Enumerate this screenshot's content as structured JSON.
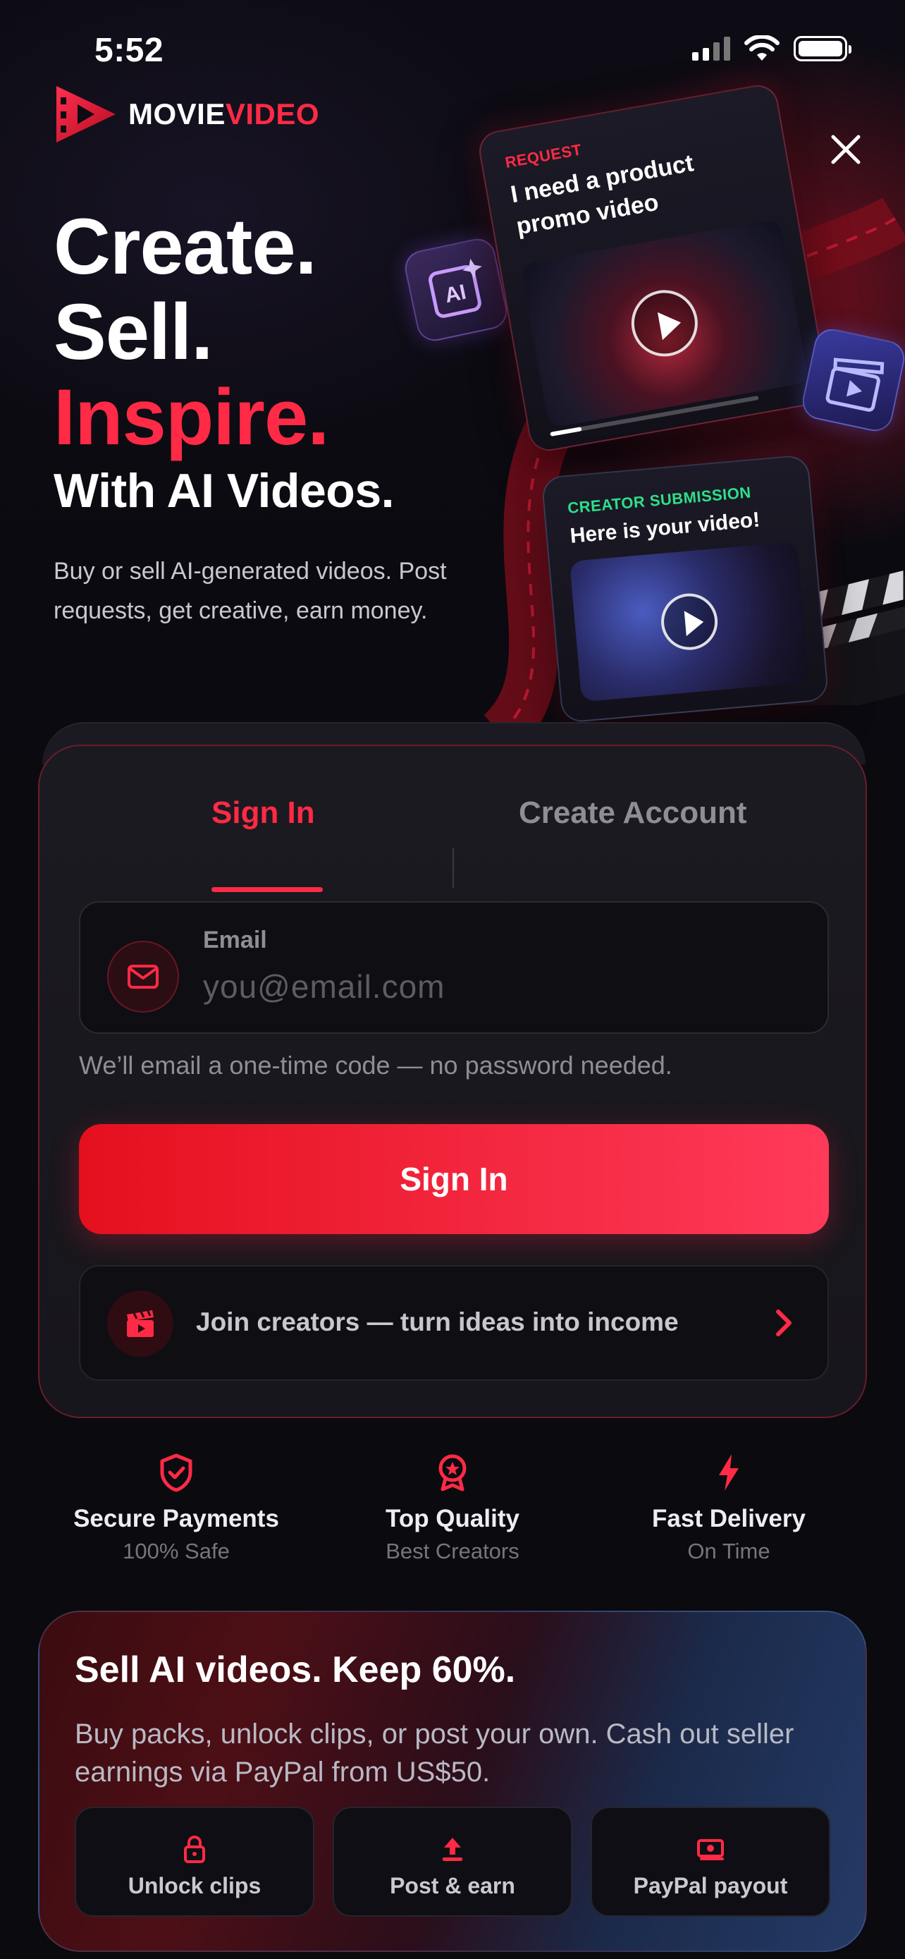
{
  "status_bar": {
    "time": "5:52"
  },
  "brand": {
    "name_part1": "MOVIE",
    "name_part2": "VIDEO"
  },
  "hero": {
    "headline_line1": "Create.",
    "headline_line2": "Sell.",
    "headline_line3": "Inspire.",
    "headline_sub": "With AI Videos.",
    "description": "Buy or sell AI-generated videos. Post requests, get creative, earn money.",
    "request_card": {
      "label": "REQUEST",
      "title": "I need a product promo video",
      "progress": 0.15
    },
    "submission_card": {
      "label": "CREATOR SUBMISSION",
      "title": "Here is your video!"
    },
    "ai_badge": "AI"
  },
  "auth": {
    "tabs": [
      {
        "label": "Sign In",
        "active": true
      },
      {
        "label": "Create Account",
        "active": false
      }
    ],
    "email": {
      "label": "Email",
      "placeholder": "you@email.com",
      "value": ""
    },
    "helper_text": "We’ll email a one-time code — no password needed.",
    "signin_button": "Sign In",
    "join_text": "Join creators — turn ideas into income"
  },
  "features": [
    {
      "icon": "shield-check-icon",
      "title": "Secure Payments",
      "subtitle": "100% Safe"
    },
    {
      "icon": "award-badge-icon",
      "title": "Top Quality",
      "subtitle": "Best Creators"
    },
    {
      "icon": "lightning-icon",
      "title": "Fast Delivery",
      "subtitle": "On Time"
    }
  ],
  "promo": {
    "title": "Sell AI videos. Keep 60%.",
    "description": "Buy packs, unlock clips, or post your own. Cash out seller earnings via PayPal from US$50.",
    "buttons": [
      {
        "icon": "lock-icon",
        "label": "Unlock clips"
      },
      {
        "icon": "upload-icon",
        "label": "Post & earn"
      },
      {
        "icon": "cash-icon",
        "label": "PayPal payout"
      }
    ]
  },
  "colors": {
    "accent": "#ff2a45",
    "background": "#0a0a0f",
    "card": "#1b1a20",
    "success": "#2ddf8a"
  }
}
